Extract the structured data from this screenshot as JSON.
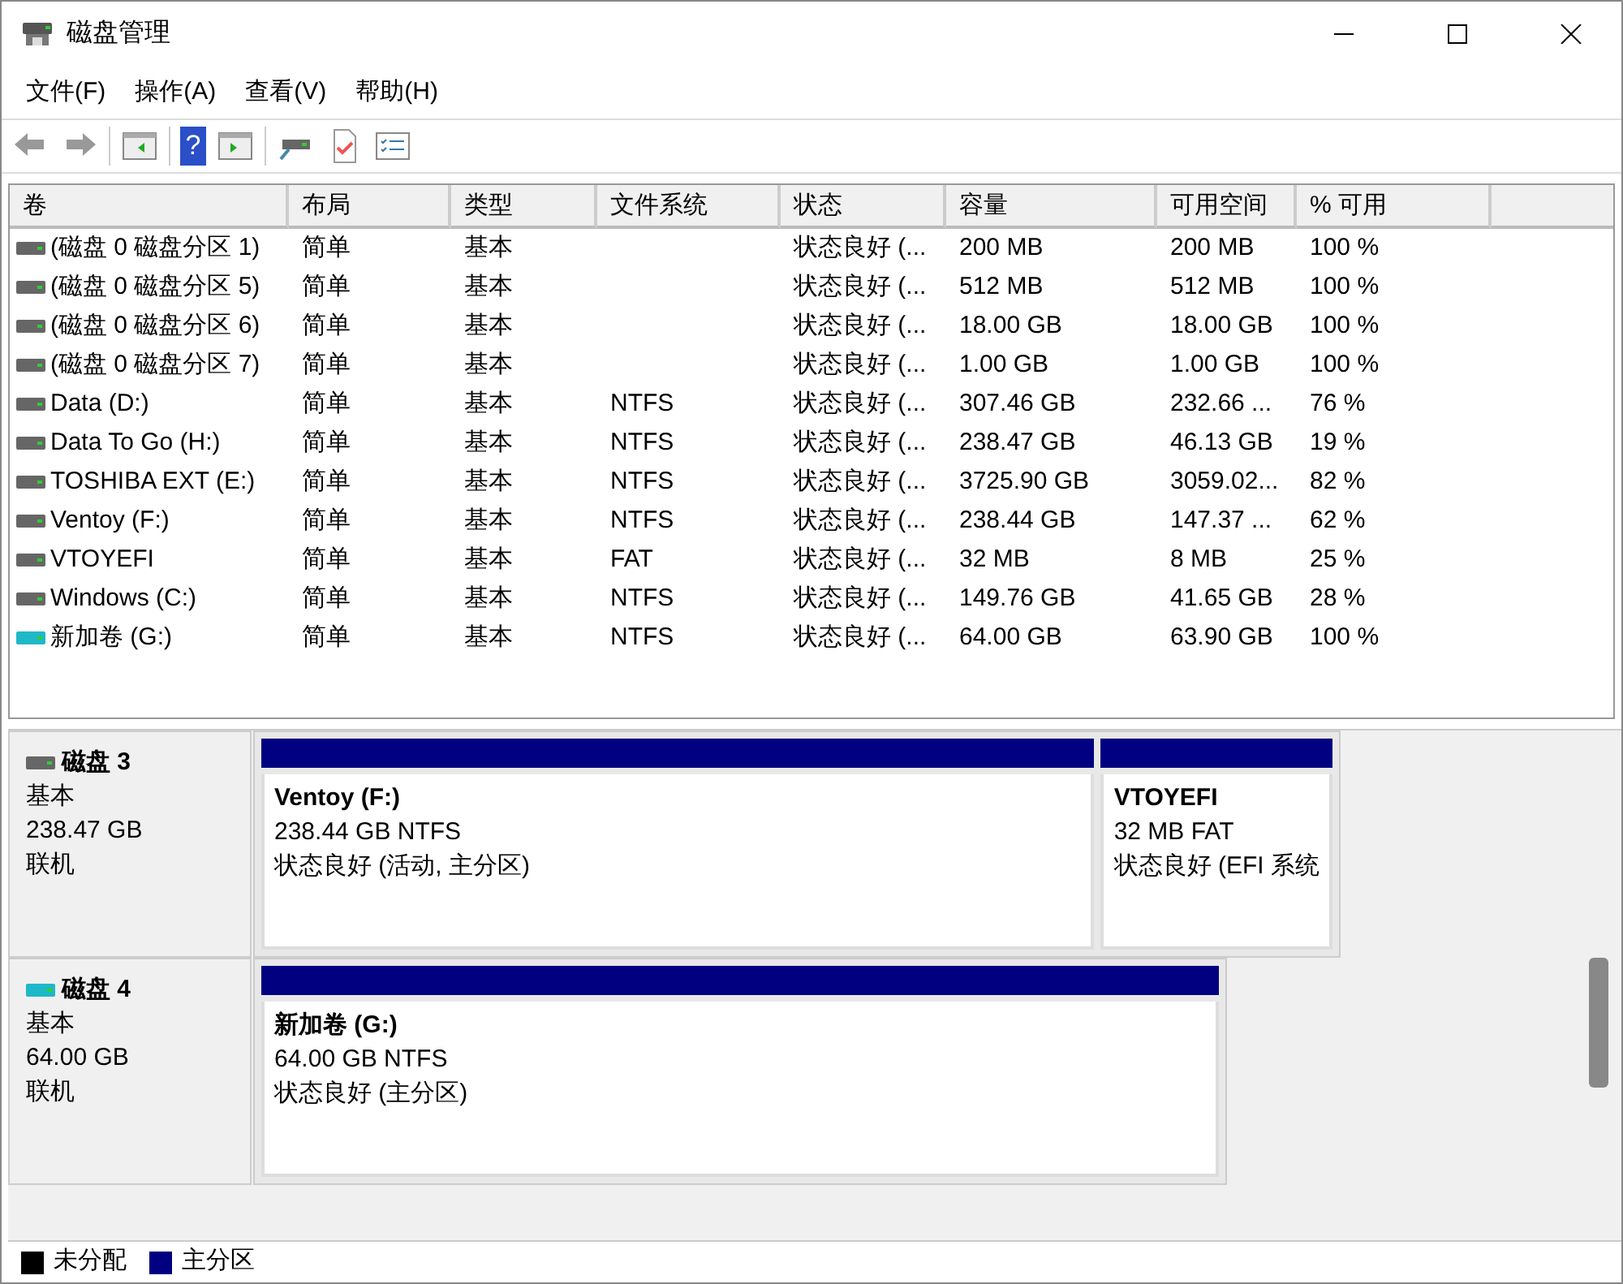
{
  "window": {
    "title": "磁盘管理"
  },
  "menu": [
    "文件(F)",
    "操作(A)",
    "查看(V)",
    "帮助(H)"
  ],
  "toolbar": {
    "help_glyph": "?"
  },
  "table": {
    "columns": [
      "卷",
      "布局",
      "类型",
      "文件系统",
      "状态",
      "容量",
      "可用空间",
      "% 可用"
    ],
    "rows": [
      {
        "kind": "hdd",
        "cells": [
          "(磁盘 0 磁盘分区 1)",
          "简单",
          "基本",
          "",
          "状态良好 (...",
          "200 MB",
          "200 MB",
          "100 %"
        ]
      },
      {
        "kind": "hdd",
        "cells": [
          "(磁盘 0 磁盘分区 5)",
          "简单",
          "基本",
          "",
          "状态良好 (...",
          "512 MB",
          "512 MB",
          "100 %"
        ]
      },
      {
        "kind": "hdd",
        "cells": [
          "(磁盘 0 磁盘分区 6)",
          "简单",
          "基本",
          "",
          "状态良好 (...",
          "18.00 GB",
          "18.00 GB",
          "100 %"
        ]
      },
      {
        "kind": "hdd",
        "cells": [
          "(磁盘 0 磁盘分区 7)",
          "简单",
          "基本",
          "",
          "状态良好 (...",
          "1.00 GB",
          "1.00 GB",
          "100 %"
        ]
      },
      {
        "kind": "hdd",
        "cells": [
          "Data (D:)",
          "简单",
          "基本",
          "NTFS",
          "状态良好 (...",
          "307.46 GB",
          "232.66 ...",
          "76 %"
        ]
      },
      {
        "kind": "hdd",
        "cells": [
          "Data To Go (H:)",
          "简单",
          "基本",
          "NTFS",
          "状态良好 (...",
          "238.47 GB",
          "46.13 GB",
          "19 %"
        ]
      },
      {
        "kind": "hdd",
        "cells": [
          "TOSHIBA EXT (E:)",
          "简单",
          "基本",
          "NTFS",
          "状态良好 (...",
          "3725.90 GB",
          "3059.02...",
          "82 %"
        ]
      },
      {
        "kind": "hdd",
        "cells": [
          "Ventoy (F:)",
          "简单",
          "基本",
          "NTFS",
          "状态良好 (...",
          "238.44 GB",
          "147.37 ...",
          "62 %"
        ]
      },
      {
        "kind": "hdd",
        "cells": [
          "VTOYEFI",
          "简单",
          "基本",
          "FAT",
          "状态良好 (...",
          "32 MB",
          "8 MB",
          "25 %"
        ]
      },
      {
        "kind": "hdd",
        "cells": [
          "Windows (C:)",
          "简单",
          "基本",
          "NTFS",
          "状态良好 (...",
          "149.76 GB",
          "41.65 GB",
          "28 %"
        ]
      },
      {
        "kind": "usb",
        "cells": [
          "新加卷 (G:)",
          "简单",
          "基本",
          "NTFS",
          "状态良好 (...",
          "64.00 GB",
          "63.90 GB",
          "100 %"
        ]
      }
    ]
  },
  "disks": [
    {
      "kind": "hdd",
      "name": "磁盘 3",
      "type": "基本",
      "size": "238.47 GB",
      "status": "联机",
      "partitions": [
        {
          "color": "#000080",
          "title": "Ventoy  (F:)",
          "size": "238.44 GB NTFS",
          "status": "状态良好 (活动, 主分区)"
        },
        {
          "color": "#000080",
          "title": "VTOYEFI",
          "size": "32 MB FAT",
          "status": "状态良好 (EFI 系统"
        }
      ]
    },
    {
      "kind": "usb",
      "name": "磁盘 4",
      "type": "基本",
      "size": "64.00 GB",
      "status": "联机",
      "partitions": [
        {
          "color": "#000080",
          "title": "新加卷  (G:)",
          "size": "64.00 GB NTFS",
          "status": "状态良好 (主分区)"
        }
      ]
    }
  ],
  "legend": [
    {
      "color": "#000000",
      "label": "未分配"
    },
    {
      "color": "#000080",
      "label": "主分区"
    }
  ]
}
